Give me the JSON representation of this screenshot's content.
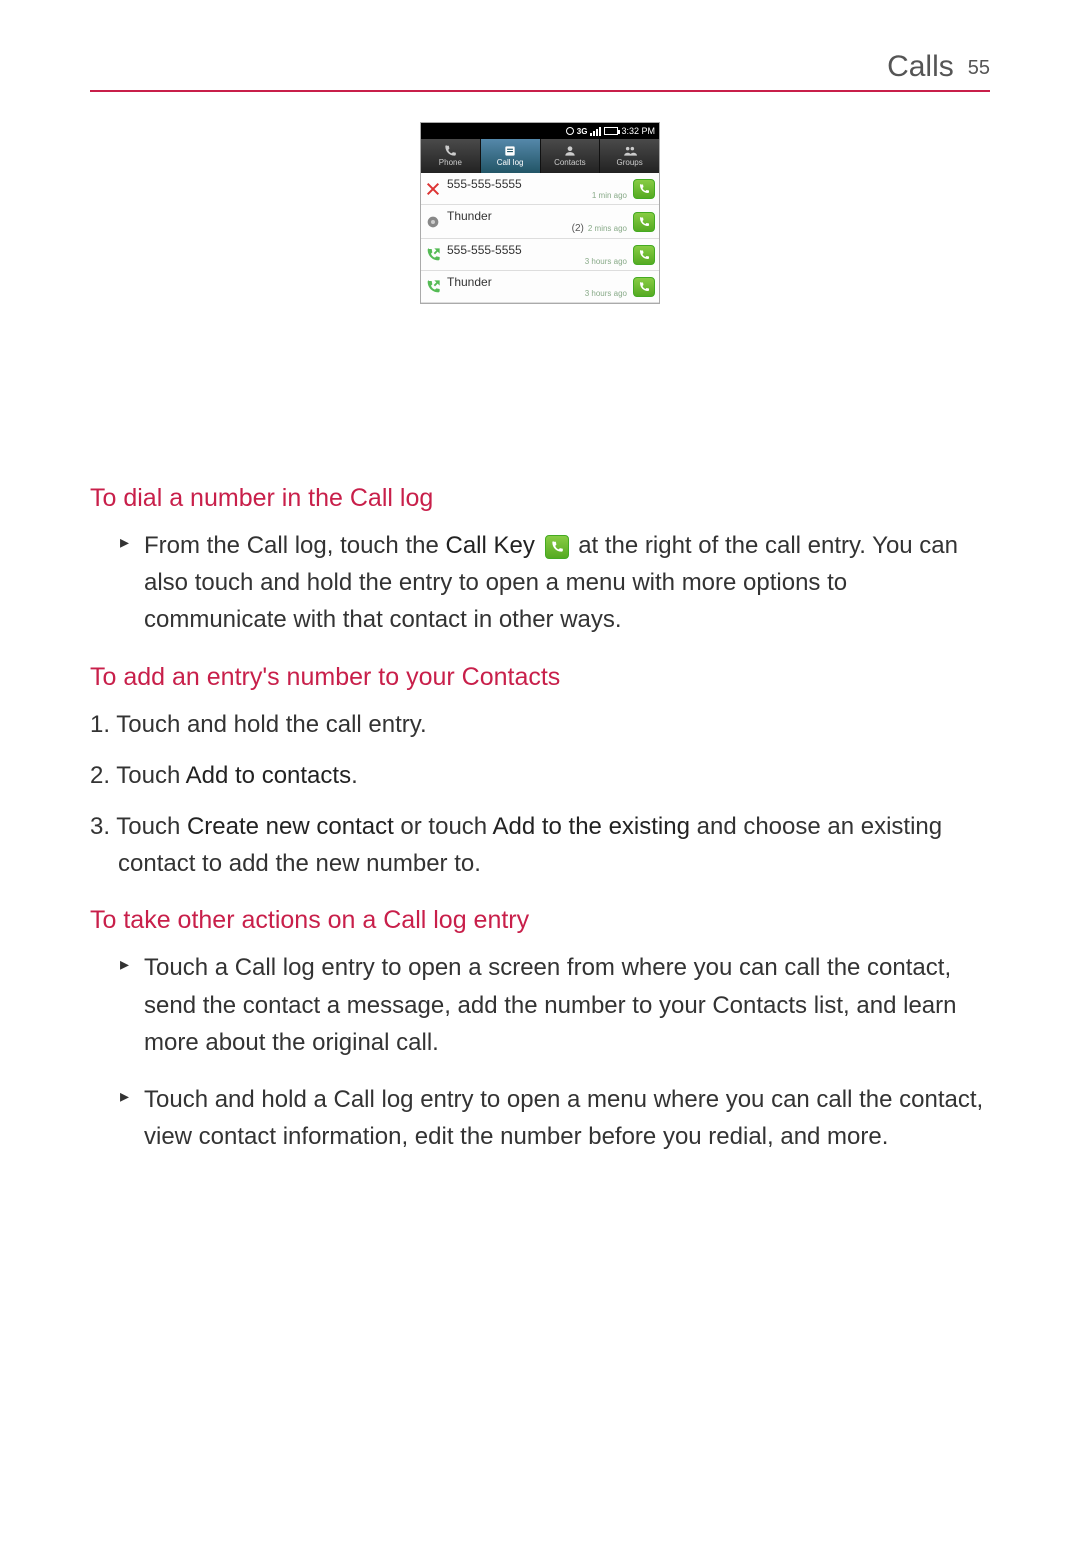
{
  "header": {
    "title": "Calls",
    "page": "55"
  },
  "phone": {
    "status": {
      "time": "3:32 PM"
    },
    "tabs": [
      "Phone",
      "Call log",
      "Contacts",
      "Groups"
    ],
    "activeTab": 1,
    "calls": [
      {
        "type": "missed",
        "name": "555-555-5555",
        "count": "",
        "time": "1 min ago"
      },
      {
        "type": "voicemail",
        "name": "Thunder",
        "count": "(2)",
        "time": "2 mins ago"
      },
      {
        "type": "outgoing",
        "name": "555-555-5555",
        "count": "",
        "time": "3 hours ago"
      },
      {
        "type": "outgoing",
        "name": "Thunder",
        "count": "",
        "time": "3 hours ago"
      }
    ]
  },
  "sections": {
    "s1": {
      "title": "To dial a number in the Call log",
      "body_a": "From the Call log, touch the ",
      "body_b": "Call Key",
      "body_c": " at the right of the call entry. You can also touch and hold the entry to open a menu with more options to communicate with that contact in other ways."
    },
    "s2": {
      "title": "To add an entry's number to your Contacts",
      "li1": "1. Touch and hold the call entry.",
      "li2a": "2. Touch ",
      "li2b": "Add to contacts",
      "li2c": ".",
      "li3a": "3. Touch ",
      "li3b": "Create new contact",
      "li3c": " or touch ",
      "li3d": "Add to the existing",
      "li3e": " and choose an existing contact to add the new number to."
    },
    "s3": {
      "title": "To take other actions on a Call log entry",
      "b1": "Touch a Call log entry to open a screen from where you can call the contact, send the contact a message, add the number to your Contacts list, and learn more about the original call.",
      "b2": "Touch and hold a Call log entry to open a menu where you can call the contact, view contact information, edit the number before you redial, and more."
    }
  }
}
